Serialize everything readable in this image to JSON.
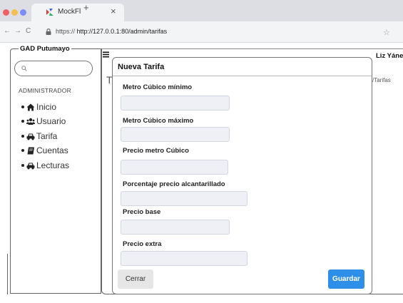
{
  "browser": {
    "tab_title": "MockFl",
    "new_tab_glyph": "+",
    "close_tab_glyph": "×",
    "back_glyph": "←",
    "forward_glyph": "→",
    "reload_glyph": "C",
    "url_scheme": "https://",
    "url_rest": "http://127.0.0.1:80/admin/tarifas",
    "bookmark_glyph": "☆",
    "traffic_light_colors": [
      "#ee5f6a",
      "#f4bf4f",
      "#7b8cf6"
    ]
  },
  "sidebar": {
    "brand": "GAD Putumayo",
    "section_label": "ADMINISTRADOR",
    "items": [
      {
        "label": "Inicio",
        "icon": "home-icon"
      },
      {
        "label": "Usuario",
        "icon": "users-icon"
      },
      {
        "label": "Tarifa",
        "icon": "car-icon"
      },
      {
        "label": "Cuentas",
        "icon": "book-icon"
      },
      {
        "label": "Lecturas",
        "icon": "car-icon"
      }
    ]
  },
  "header": {
    "user_name": "Liz Yánez"
  },
  "background": {
    "page_title": "T",
    "breadcrumb": "/Tarifas"
  },
  "modal": {
    "title": "Nueva Tarifa",
    "fields": [
      {
        "label": "Metro Cúbico mínimo",
        "value": ""
      },
      {
        "label": "Metro Cúbico máximo",
        "value": ""
      },
      {
        "label": "Precio metro Cúbico",
        "value": ""
      },
      {
        "label": "Porcentaje precio alcantarillado",
        "value": ""
      },
      {
        "label": "Precio base",
        "value": ""
      },
      {
        "label": "Precio extra",
        "value": ""
      }
    ],
    "cancel_label": "Cerrar",
    "save_label": "Guardar"
  },
  "colors": {
    "primary_button": "#2e8fe8",
    "input_fill": "#eef0f5"
  }
}
